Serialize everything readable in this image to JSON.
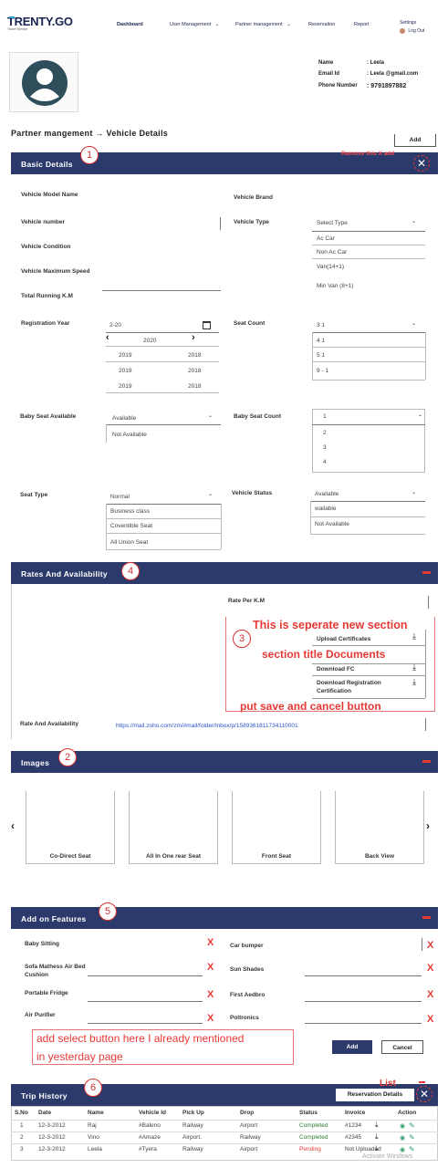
{
  "app": {
    "logo": "TRENTY.GO",
    "logo_sub": "Travel Service"
  },
  "nav": {
    "dashboard": "Dashboard",
    "user_mgmt": "User Management",
    "partner_mgmt": "Partner management",
    "reservation": "Reservation",
    "report": "Report",
    "settings": "Settings",
    "logout": "Log Out"
  },
  "profile": {
    "name_label": "Name",
    "name_value": "Leela",
    "email_label": "Email Id",
    "email_value": "Leela @gmail.com",
    "phone_label": "Phone Number",
    "phone_value": "9791897882"
  },
  "breadcrumb": "Partner mangement → Vehicle Details",
  "add_top": "Add",
  "basic": {
    "title": "Basic Details",
    "annot_num": "1",
    "remove_note": "Remove this X add",
    "vehicle_model": "Vehicle Model Name",
    "vehicle_brand": "Vehicle Brand",
    "vehicle_number": "Vehicle number",
    "vehicle_type": "Vehicle  Type",
    "vehicle_type_select": "Select Type",
    "vehicle_type_opts": [
      "Ac Car",
      "Non Ac Car",
      "Van(14+1)",
      "Min  Van (8+1)"
    ],
    "vehicle_condition": "Vehicle Condition",
    "vehicle_max_speed": "Vehicle Maximum Speed",
    "total_running": "Total Running K.M",
    "reg_year": "Registration Year",
    "reg_year_value": "2-20",
    "cal_year": "2020",
    "cal_years": [
      "2019",
      "2018",
      "2019",
      "2018",
      "2019",
      "2018"
    ],
    "seat_count": "Seat Count",
    "seat_count_opts": [
      "3  1",
      "4  1",
      "5  1",
      "9 - 1"
    ],
    "baby_seat_avail": "Baby Seat Available",
    "baby_seat_avail_value": "Available",
    "baby_seat_avail_opt": "Not Available",
    "baby_seat_count": "Baby Seat Count",
    "baby_seat_count_opts": [
      "1",
      "2",
      "3",
      "4"
    ],
    "seat_type": "Seat Type",
    "seat_type_value": "Normal",
    "seat_type_opts": [
      "Business class",
      "Coventible Seat",
      "All Union Seat"
    ],
    "vehicle_status": "Vehicle Status",
    "vehicle_status_value": "Available",
    "vehicle_status_opts": [
      "wailable",
      "Not Available"
    ]
  },
  "rates": {
    "title": "Rates And Availability",
    "annot_num": "4",
    "rate_per_km": "Rate Per K.M",
    "note_annot_num": "3",
    "note1": "This is seperate new section",
    "note2": "section title Documents",
    "note3": "put save and cancel button",
    "upload_cert": "Upload Certificates",
    "download_fc": "Download FC",
    "download_reg": "Download Registration Certification",
    "rate_avail": "Rate And Availability",
    "rate_link": "https://mail.zoho.com/zm/#mail/folder/inbox/p/1589361811734110001"
  },
  "images": {
    "title": "Images",
    "annot_num": "2",
    "cards": [
      "Co-Direct Seat",
      "All In One rear Seat",
      "Front Seat",
      "Back View"
    ]
  },
  "features": {
    "title": "Add on Features",
    "annot_num": "5",
    "left": [
      "Baby Sitting",
      "Sofa Mathess Air Bed Cushion",
      "Portable Fridge",
      "Air Purifier"
    ],
    "right": [
      "Car bumper",
      "Sun Shades",
      "First Aedbro",
      "Poltronics"
    ],
    "note1": "add select button here I already mentioned",
    "note2": "in yesterday page",
    "add": "Add",
    "cancel": "Cancel"
  },
  "trip": {
    "title": "Trip History",
    "annot_num": "6",
    "list_note": "List",
    "reservation_btn": "Reservation Details",
    "headers": [
      "S.No",
      "Date",
      "Name",
      "Vehicle Id",
      "Pick Up",
      "Drop",
      "Status",
      "Invoice",
      "Action"
    ],
    "rows": [
      [
        "1",
        "12-3-2012",
        "Raj",
        "#Baleno",
        "Railway",
        "Airport",
        "Completed",
        "#1234"
      ],
      [
        "2",
        "12-3-2012",
        "Vino",
        "#Amaze",
        "Airport.",
        "Railway",
        "Completed",
        "#2345"
      ],
      [
        "3",
        "12-3-2012",
        "Leela",
        "#Tyera",
        "Railway",
        "Airport",
        "Pending",
        "Not  Uploaded"
      ]
    ],
    "status_colors": {
      "Completed": "#2e7d32",
      "Pending": "#e53935"
    }
  },
  "watermark": "Activate Windows",
  "colors": {
    "header_bar": "#2b3a6b",
    "annotation": "#d32f2f",
    "accent": "#e53935"
  }
}
